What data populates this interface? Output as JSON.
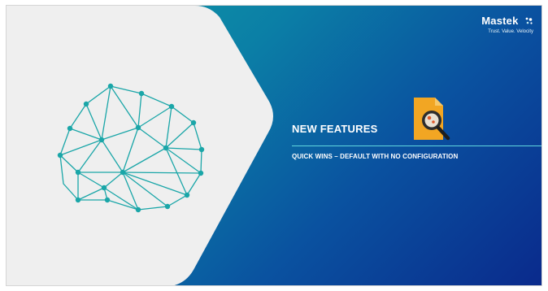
{
  "slide": {
    "brand": {
      "name": "Mastek",
      "tagline": "Trust. Value. Velocity"
    },
    "title": "NEW FEATURES",
    "subtitle": "QUICK WINS – DEFAULT WITH NO CONFIGURATION",
    "icons": {
      "brain": "brain-network-icon",
      "file_search": "file-search-icon",
      "brand_mark": "mastek-logo-mark"
    },
    "colors": {
      "gradient_start": "#11a0a8",
      "gradient_end": "#0a2a8c",
      "panel": "#efefef",
      "network": "#1aa6a8",
      "rule": "#5fd6de",
      "file_icon": "#f2a623"
    }
  }
}
